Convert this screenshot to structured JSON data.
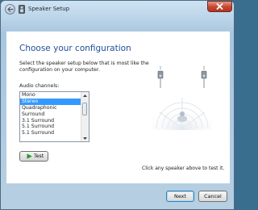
{
  "window": {
    "title": "Speaker Setup",
    "close_icon": "close-icon",
    "back_icon": "back-arrow-icon"
  },
  "page": {
    "heading": "Choose your configuration",
    "instruction": "Select the speaker setup below that is most like the configuration on your computer.",
    "channels_label": "Audio channels:",
    "channels": [
      "Mono",
      "Stereo",
      "Quadraphonic",
      "Surround",
      "3.1 Surround",
      "5.1 Surround",
      "5.1 Surround"
    ],
    "selected_channel": "Stereo",
    "test_label": "Test",
    "hint": "Click any speaker above to test it."
  },
  "footer": {
    "next_label": "Next",
    "cancel_label": "Cancel"
  },
  "colors": {
    "heading": "#1e4f9a",
    "selection": "#3399ff",
    "close_button": "#c8452f",
    "play_icon": "#2a9a2a"
  }
}
